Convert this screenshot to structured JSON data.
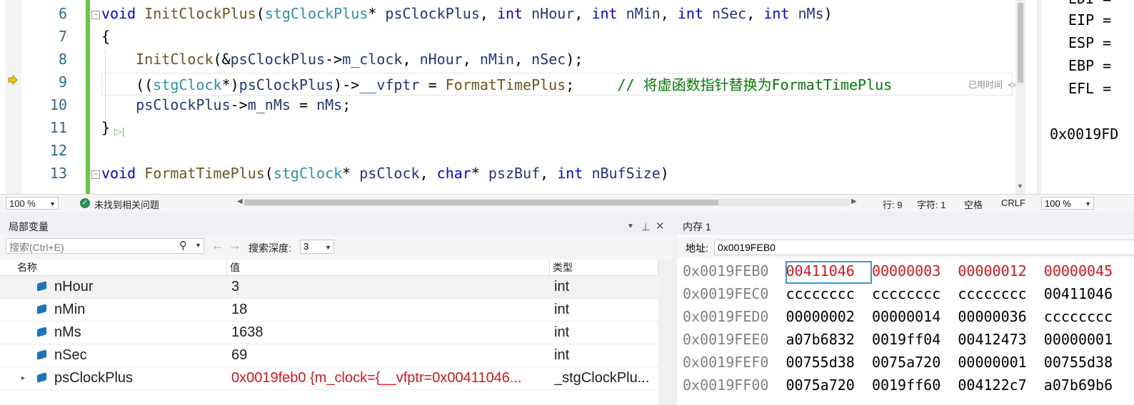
{
  "editor": {
    "lines": [
      {
        "n": "6",
        "tokens": [
          [
            "kw",
            "void"
          ],
          [
            "op",
            " "
          ],
          [
            "fn",
            "InitClockPlus"
          ],
          [
            "op",
            "("
          ],
          [
            "ty",
            "stgClockPlus"
          ],
          [
            "op",
            "* "
          ],
          [
            "var",
            "psClockPlus"
          ],
          [
            "op",
            ", "
          ],
          [
            "kw",
            "int"
          ],
          [
            "op",
            " "
          ],
          [
            "var",
            "nHour"
          ],
          [
            "op",
            ", "
          ],
          [
            "kw",
            "int"
          ],
          [
            "op",
            " "
          ],
          [
            "var",
            "nMin"
          ],
          [
            "op",
            ", "
          ],
          [
            "kw",
            "int"
          ],
          [
            "op",
            " "
          ],
          [
            "var",
            "nSec"
          ],
          [
            "op",
            ", "
          ],
          [
            "kw",
            "int"
          ],
          [
            "op",
            " "
          ],
          [
            "var",
            "nMs"
          ],
          [
            "op",
            ")"
          ]
        ]
      },
      {
        "n": "7",
        "tokens": [
          [
            "op",
            "{"
          ]
        ]
      },
      {
        "n": "8",
        "tokens": [
          [
            "op",
            "    "
          ],
          [
            "fn",
            "InitClock"
          ],
          [
            "op",
            "(&"
          ],
          [
            "var",
            "psClockPlus"
          ],
          [
            "op",
            "->"
          ],
          [
            "var",
            "m_clock"
          ],
          [
            "op",
            ", "
          ],
          [
            "var",
            "nHour"
          ],
          [
            "op",
            ", "
          ],
          [
            "var",
            "nMin"
          ],
          [
            "op",
            ", "
          ],
          [
            "var",
            "nSec"
          ],
          [
            "op",
            ");"
          ]
        ]
      },
      {
        "n": "9",
        "tokens": [
          [
            "op",
            "    (("
          ],
          [
            "ty",
            "stgClock"
          ],
          [
            "op",
            "*)"
          ],
          [
            "var",
            "psClockPlus"
          ],
          [
            "op",
            ")->"
          ],
          [
            "var",
            "__vfptr"
          ],
          [
            "op",
            " = "
          ],
          [
            "fn",
            "FormatTimePlus"
          ],
          [
            "op",
            ";     "
          ],
          [
            "cmt",
            "// 将虚函数指针替换为FormatTimePlus"
          ]
        ]
      },
      {
        "n": "10",
        "tokens": [
          [
            "op",
            "    "
          ],
          [
            "var",
            "psClockPlus"
          ],
          [
            "op",
            "->"
          ],
          [
            "var",
            "m_nMs"
          ],
          [
            "op",
            " = "
          ],
          [
            "var",
            "nMs"
          ],
          [
            "op",
            ";"
          ]
        ]
      },
      {
        "n": "11",
        "tokens": [
          [
            "op",
            "}"
          ]
        ]
      },
      {
        "n": "12",
        "tokens": []
      },
      {
        "n": "13",
        "tokens": [
          [
            "kw",
            "void"
          ],
          [
            "op",
            " "
          ],
          [
            "fn",
            "FormatTimePlus"
          ],
          [
            "op",
            "("
          ],
          [
            "ty",
            "stgClock"
          ],
          [
            "op",
            "* "
          ],
          [
            "var",
            "psClock"
          ],
          [
            "op",
            ", "
          ],
          [
            "kw",
            "char"
          ],
          [
            "op",
            "* "
          ],
          [
            "var",
            "pszBuf"
          ],
          [
            "op",
            ", "
          ],
          [
            "kw",
            "int"
          ],
          [
            "op",
            " "
          ],
          [
            "var",
            "nBufSize"
          ],
          [
            "op",
            ")"
          ]
        ]
      }
    ],
    "time_hint": "已用时间 <="
  },
  "editor_status": {
    "zoom": "100 %",
    "issues": "未找到相关问题",
    "line": "行: 9",
    "char": "字符: 1",
    "whitespace": "空格",
    "eol": "CRLF"
  },
  "registers": {
    "rows": [
      "EDI =",
      "EIP =",
      "ESP =",
      "EBP =",
      "EFL ="
    ],
    "addr": "0x0019FD",
    "zoom": "100 %"
  },
  "locals": {
    "title": "局部变量",
    "search_placeholder": "搜索(Ctrl+E)",
    "depth_label": "搜索深度:",
    "depth_value": "3",
    "columns": [
      "名称",
      "值",
      "类型"
    ],
    "rows": [
      {
        "name": "nHour",
        "value": "3",
        "type": "int",
        "changed": false,
        "expandable": false
      },
      {
        "name": "nMin",
        "value": "18",
        "type": "int",
        "changed": false,
        "expandable": false
      },
      {
        "name": "nMs",
        "value": "1638",
        "type": "int",
        "changed": false,
        "expandable": false
      },
      {
        "name": "nSec",
        "value": "69",
        "type": "int",
        "changed": false,
        "expandable": false
      },
      {
        "name": "psClockPlus",
        "value": "0x0019feb0 {m_clock={__vfptr=0x00411046...",
        "type": "_stgClockPlu...",
        "changed": true,
        "expandable": true
      }
    ]
  },
  "memory": {
    "title": "内存 1",
    "addr_label": "地址:",
    "addr_value": "0x0019FEB0",
    "rows": [
      {
        "addr": "0x0019FEB0",
        "words": [
          "00411046",
          "00000003",
          "00000012",
          "00000045"
        ],
        "red": [
          true,
          true,
          true,
          true
        ]
      },
      {
        "addr": "0x0019FEC0",
        "words": [
          "cccccccc",
          "cccccccc",
          "cccccccc",
          "00411046"
        ],
        "red": [
          false,
          false,
          false,
          false
        ]
      },
      {
        "addr": "0x0019FED0",
        "words": [
          "00000002",
          "00000014",
          "00000036",
          "cccccccc"
        ],
        "red": [
          false,
          false,
          false,
          false
        ]
      },
      {
        "addr": "0x0019FEE0",
        "words": [
          "a07b6832",
          "0019ff04",
          "00412473",
          "00000001"
        ],
        "red": [
          false,
          false,
          false,
          false
        ]
      },
      {
        "addr": "0x0019FEF0",
        "words": [
          "00755d38",
          "0075a720",
          "00000001",
          "00755d38"
        ],
        "red": [
          false,
          false,
          false,
          false
        ]
      },
      {
        "addr": "0x0019FF00",
        "words": [
          "0075a720",
          "0019ff60",
          "004122c7",
          "a07b69b6"
        ],
        "red": [
          false,
          false,
          false,
          false
        ]
      }
    ]
  },
  "colors": {
    "accent": "#3399dd",
    "changed": "#e0141e",
    "keyword": "#0000ff",
    "type": "#2b91af",
    "function": "#74531f",
    "comment": "#008000"
  }
}
